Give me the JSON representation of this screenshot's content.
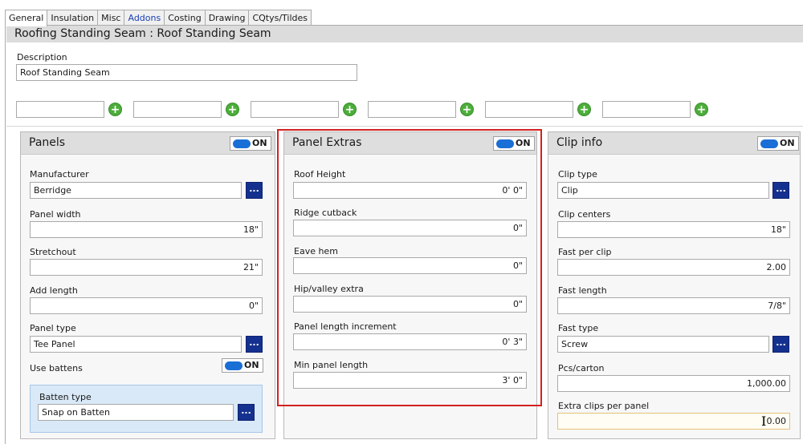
{
  "tabs": [
    {
      "label": "General"
    },
    {
      "label": "Insulation"
    },
    {
      "label": "Misc"
    },
    {
      "label": "Addons"
    },
    {
      "label": "Costing"
    },
    {
      "label": "Drawing"
    },
    {
      "label": "CQtys/Tildes"
    }
  ],
  "page_title": "Roofing Standing Seam : Roof Standing Seam",
  "description": {
    "label": "Description",
    "value": "Roof Standing Seam"
  },
  "extra_fields": [
    "",
    "",
    "",
    "",
    "",
    ""
  ],
  "add_icon_symbol": "+",
  "panels": {
    "title": "Panels",
    "toggle": "ON",
    "manufacturer": {
      "label": "Manufacturer",
      "value": "Berridge"
    },
    "panel_width": {
      "label": "Panel width",
      "value": "18\""
    },
    "stretchout": {
      "label": "Stretchout",
      "value": "21\""
    },
    "add_length": {
      "label": "Add length",
      "value": "0\""
    },
    "panel_type": {
      "label": "Panel type",
      "value": "Tee Panel"
    },
    "use_battens": {
      "label": "Use battens",
      "toggle": "ON"
    },
    "batten_type": {
      "label": "Batten type",
      "value": "Snap on Batten"
    }
  },
  "panel_extras": {
    "title": "Panel Extras",
    "toggle": "ON",
    "roof_height": {
      "label": "Roof Height",
      "value": "0' 0\""
    },
    "ridge_cutback": {
      "label": "Ridge cutback",
      "value": "0\""
    },
    "eave_hem": {
      "label": "Eave hem",
      "value": "0\""
    },
    "hip_valley_extra": {
      "label": "Hip/valley extra",
      "value": "0\""
    },
    "panel_length_increment": {
      "label": "Panel length increment",
      "value": "0' 3\""
    },
    "min_panel_length": {
      "label": "Min panel length",
      "value": "3' 0\""
    }
  },
  "clip_info": {
    "title": "Clip info",
    "toggle": "ON",
    "clip_type": {
      "label": "Clip type",
      "value": "Clip"
    },
    "clip_centers": {
      "label": "Clip centers",
      "value": "18\""
    },
    "fast_per_clip": {
      "label": "Fast per clip",
      "value": "2.00"
    },
    "fast_length": {
      "label": "Fast length",
      "value": "7/8\""
    },
    "fast_type": {
      "label": "Fast type",
      "value": "Screw"
    },
    "pcs_carton": {
      "label": "Pcs/carton",
      "value": "1,000.00"
    },
    "extra_clips_per_panel": {
      "label": "Extra clips per panel",
      "value": "0.00"
    }
  },
  "browse_button_label": "...",
  "colors": {
    "accent_link": "#1a3fb5",
    "add_green": "#4cae3a",
    "browse_navy": "#15318f",
    "toggle_blue": "#1a6fd6",
    "highlight_red": "#d42020",
    "batten_box_bg": "#d9e9f8"
  },
  "icons": {
    "add": "plus-circle-icon",
    "browse": "ellipsis-icon",
    "cursor": "text-cursor-icon"
  }
}
